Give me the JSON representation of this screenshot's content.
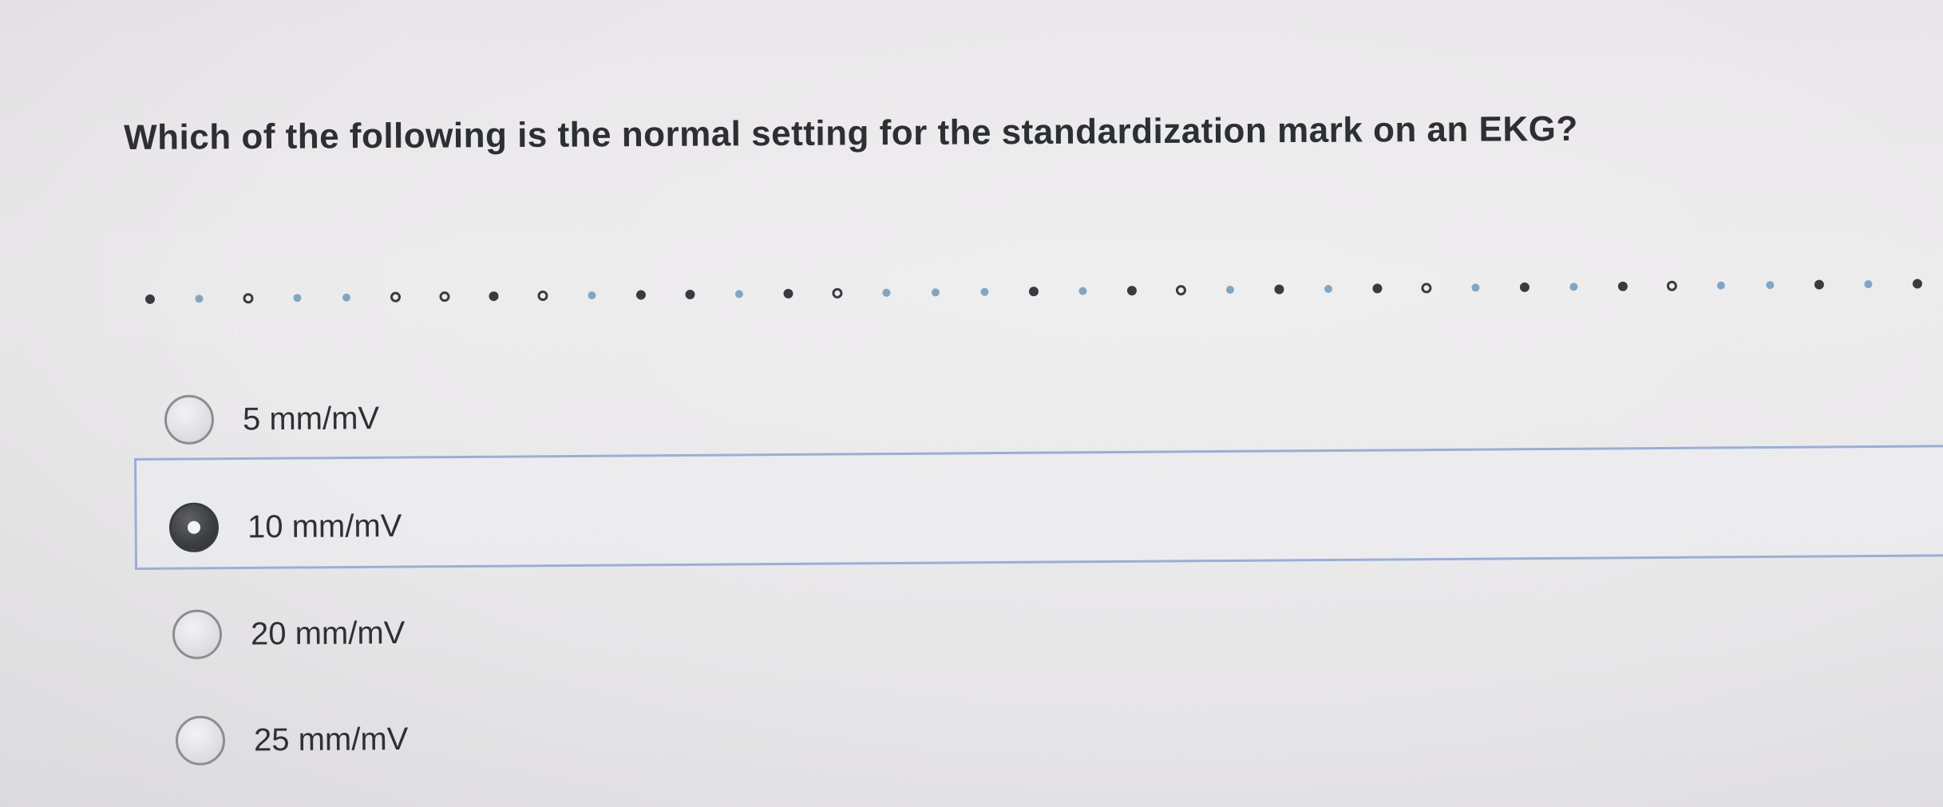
{
  "question": {
    "text": "Which of the following is the normal setting for the standardization mark on an EKG?"
  },
  "options": [
    {
      "label": "5 mm/mV",
      "selected": false
    },
    {
      "label": "10 mm/mV",
      "selected": true
    },
    {
      "label": "20 mm/mV",
      "selected": false
    },
    {
      "label": "25 mm/mV",
      "selected": false
    }
  ],
  "colors": {
    "selected_border": "#9aaed6",
    "radio_selected": "#3c3d42",
    "radio_unselected": "#dcdce0"
  }
}
